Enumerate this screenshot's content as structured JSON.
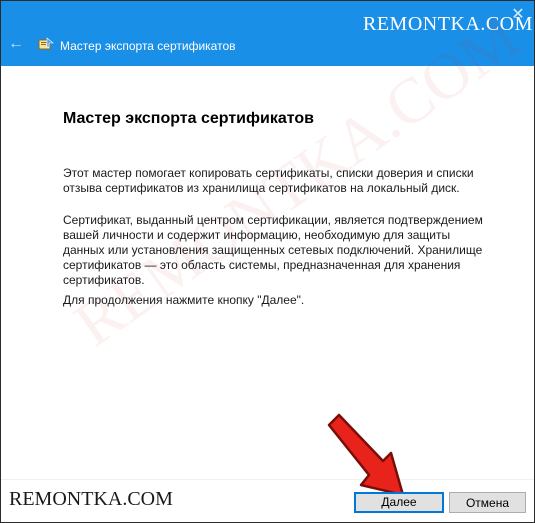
{
  "window": {
    "title": "Мастер экспорта сертификатов",
    "accent_color": "#1a8fe8",
    "back_icon": "back-arrow-icon",
    "close_icon": "close-icon",
    "app_icon": "certificate-wizard-icon"
  },
  "watermarks": {
    "top": "REMONTKA.COM",
    "bottom": "REMONTKA.COM",
    "diagonal": "REMONTKA.COM"
  },
  "content": {
    "heading": "Мастер экспорта сертификатов",
    "paragraph1": "Этот мастер помогает копировать сертификаты, списки доверия и списки отзыва сертификатов из хранилища сертификатов на локальный диск.",
    "paragraph2": "Сертификат, выданный центром сертификации, является подтверждением вашей личности и содержит информацию, необходимую для защиты данных или установления защищенных сетевых подключений. Хранилище сертификатов — это область системы, предназначенная для хранения сертификатов.",
    "paragraph3": "Для продолжения нажмите кнопку \"Далее\"."
  },
  "buttons": {
    "next": "Далее",
    "cancel": "Отмена"
  },
  "annotation": {
    "arrow_icon": "red-arrow-icon",
    "arrow_color": "#e8231b"
  }
}
